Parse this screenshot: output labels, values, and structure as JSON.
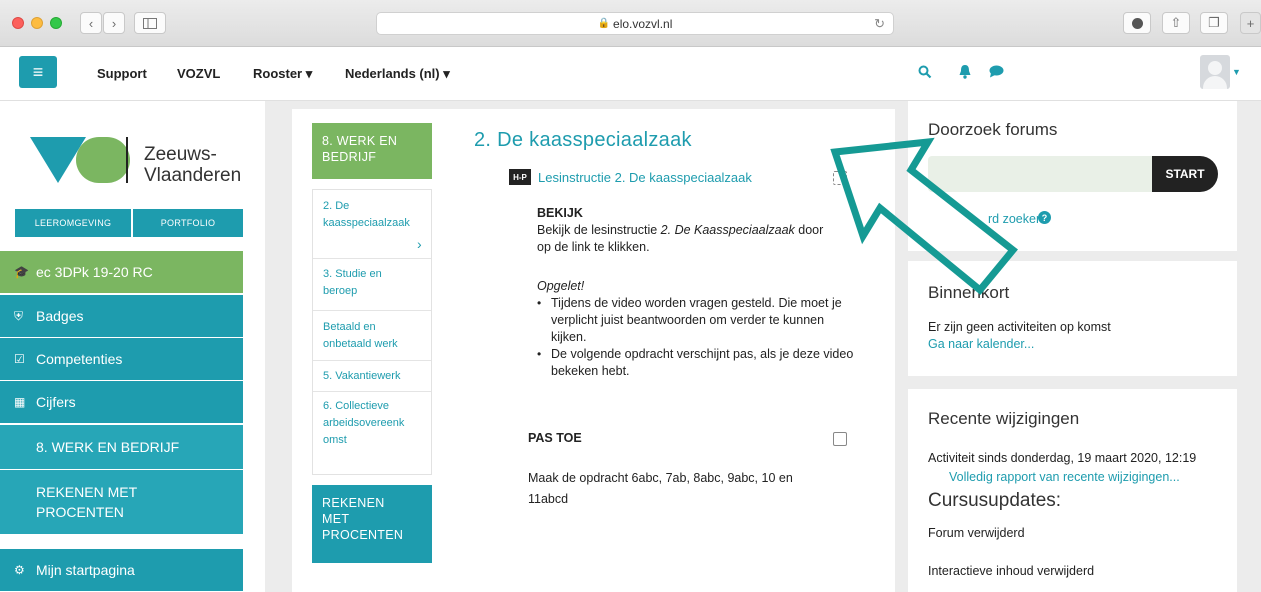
{
  "browser": {
    "url": "elo.vozvl.nl",
    "back_label": "‹",
    "forward_label": "›"
  },
  "navbar": {
    "menu_icon": "≡",
    "links": [
      "Support",
      "VOZVL",
      "Rooster ▾",
      "Nederlands (nl) ▾"
    ]
  },
  "sidebar": {
    "logo_text_line1": "Zeeuws-",
    "logo_text_line2": "Vlaanderen",
    "tabs": [
      "LEEROMGEVING",
      "PORTFOLIO"
    ],
    "course": "ec 3DPk 19-20 RC",
    "items": [
      {
        "label": "Badges",
        "icon": "shield-icon"
      },
      {
        "label": "Competenties",
        "icon": "checkbox-icon"
      },
      {
        "label": "Cijfers",
        "icon": "table-icon"
      }
    ],
    "sections": [
      "8. WERK EN BEDRIJF",
      "REKENEN MET\nPROCENTEN"
    ],
    "startpage": "Mijn startpagina"
  },
  "section_nav": {
    "head": "8. WERK EN\nBEDRIJF",
    "links": [
      "2. De\nkaasspeciaalzaak",
      "3. Studie en\nberoep",
      "Betaald en\nonbetaald werk",
      "5. Vakantiewerk",
      "6. Collectieve\narbeidsovereenk\nomst"
    ],
    "active_chevron": "›",
    "foot": "REKENEN\nMET\nPROCENTEN"
  },
  "main": {
    "title": "2. De kaasspeciaalzaak",
    "hp_icon_label": "H-P",
    "lesson_link": "Lesinstructie 2. De kaasspeciaalzaak",
    "bekijk_heading": "BEKIJK",
    "bekijk_text_1": "Bekijk de lesinstructie ",
    "bekijk_text_em": "2. De Kaasspeciaalzaak",
    "bekijk_text_2": " door",
    "bekijk_text_3": "op de link te klikken.",
    "opgelet": "Opgelet!",
    "bullets": [
      "Tijdens de video worden vragen gesteld. Die moet je verplicht juist beantwoorden om verder te kunnen kijken.",
      "De volgende opdracht verschijnt pas, als je deze video bekeken hebt."
    ],
    "pas_toe_heading": "PAS TOE",
    "pas_toe_text": "Maak de opdracht 6abc, 7ab, 8abc, 9abc, 10 en\n11abcd"
  },
  "right": {
    "search_title": "Doorzoek forums",
    "search_button": "START",
    "advanced_search": "rd zoeken",
    "binnenkort_title": "Binnenkort",
    "binnenkort_text": "Er zijn geen activiteiten op komst",
    "calendar_link": "Ga naar kalender...",
    "recent_title": "Recente wijzigingen",
    "recent_since": "Activiteit sinds donderdag, 19 maart 2020, 12:19",
    "recent_link": "Volledig rapport van recente wijzigingen...",
    "updates_title": "Cursusupdates:",
    "update_1": "Forum verwijderd",
    "update_2": "Interactieve inhoud verwijderd"
  },
  "colors": {
    "teal": "#1e9cae",
    "green": "#7bb661",
    "arrow": "#159a94"
  }
}
